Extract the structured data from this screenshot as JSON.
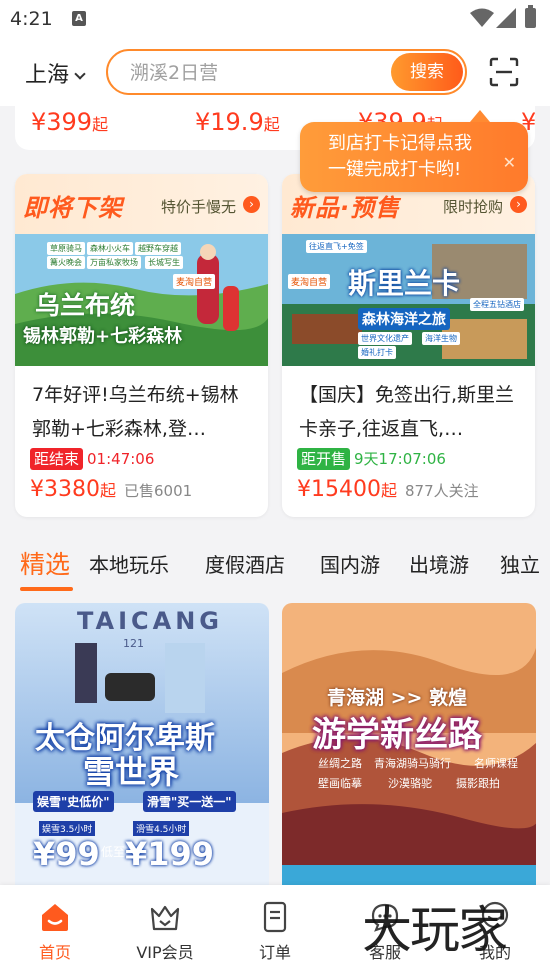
{
  "status_bar": {
    "time": "4:21",
    "notification_icon": "A"
  },
  "header": {
    "city": "上海",
    "search_placeholder": "溯溪2日营",
    "search_button": "搜索"
  },
  "price_strip": [
    {
      "price": "¥399",
      "suffix": "起"
    },
    {
      "price": "¥19.9",
      "suffix": "起"
    },
    {
      "price": "¥39.9",
      "suffix": "起"
    },
    {
      "price": "¥",
      "suffix": ""
    }
  ],
  "tooltip": {
    "line1": "到店打卡记得点我",
    "line2": "一键完成打卡哟!",
    "close": "✕"
  },
  "deals": [
    {
      "banner_title": "即将下架",
      "banner_sub": "特价手慢无",
      "image_caption_main": "乌兰布统",
      "image_caption_sub": "锡林郭勒+七彩森林",
      "image_tags": [
        "草原骑马",
        "森林小火车",
        "越野车穿越",
        "篝火晚会",
        "万亩私家牧场",
        "长城写生"
      ],
      "image_badge": "麦淘自营",
      "title": "7年好评!乌兰布统+锡林郭勒+七彩森林,登…",
      "timer_label": "距结束",
      "timer_value": "01:47:06",
      "timer_color": "#f0242a",
      "price": "¥3380",
      "price_suffix": "起",
      "meta": "已售6001"
    },
    {
      "banner_title": "新品·预售",
      "banner_sub": "限时抢购",
      "image_caption_main": "斯里兰卡",
      "image_caption_sub": "森林海洋之旅",
      "image_tags": [
        "往返直飞+免签",
        "麦淘自营",
        "全程五钻酒店",
        "世界文化遗产",
        "海洋生物",
        "婚礼打卡"
      ],
      "image_badge": "麦淘自营",
      "title": "【国庆】免签出行,斯里兰卡亲子,往返直飞,…",
      "timer_label": "距开售",
      "timer_value": "9天17:07:06",
      "timer_color": "#2fb344",
      "price": "¥15400",
      "price_suffix": "起",
      "meta": "877人关注"
    }
  ],
  "tabs": [
    "精选",
    "本地玩乐",
    "度假酒店",
    "国内游",
    "出境游",
    "独立"
  ],
  "products": [
    {
      "top_text": "TAICANG",
      "top_num": "121",
      "title_line1": "太仓阿尔卑斯",
      "title_line2": "雪世界",
      "badge": "娱雪\"史低价\"",
      "badge2": "滑雪\"买一送一\"",
      "price1_label": "娱雪3.5小时",
      "price1": "¥99",
      "price2_label": "滑雪4.5小时",
      "price2": "¥199",
      "mid": "低至"
    },
    {
      "top_line": "青海湖 >> 敦煌",
      "title": "游学新丝路",
      "tags": [
        "丝绸之路",
        "青海湖骑马骑行",
        "名师课程",
        "壁画临摹",
        "沙漠骆驼",
        "摄影跟拍"
      ]
    }
  ],
  "bottom_nav": [
    {
      "label": "首页",
      "icon": "home-icon",
      "active": true
    },
    {
      "label": "VIP会员",
      "icon": "vip-icon",
      "active": false
    },
    {
      "label": "订单",
      "icon": "order-icon",
      "active": false
    },
    {
      "label": "客服",
      "icon": "chat-icon",
      "active": false
    },
    {
      "label": "我的",
      "icon": "profile-icon",
      "active": false
    }
  ],
  "watermark": "大玩家",
  "colors": {
    "accent": "#ff6a1a",
    "price": "#ff3b1f",
    "countdown_red": "#f0242a",
    "presale_green": "#2fb344"
  }
}
